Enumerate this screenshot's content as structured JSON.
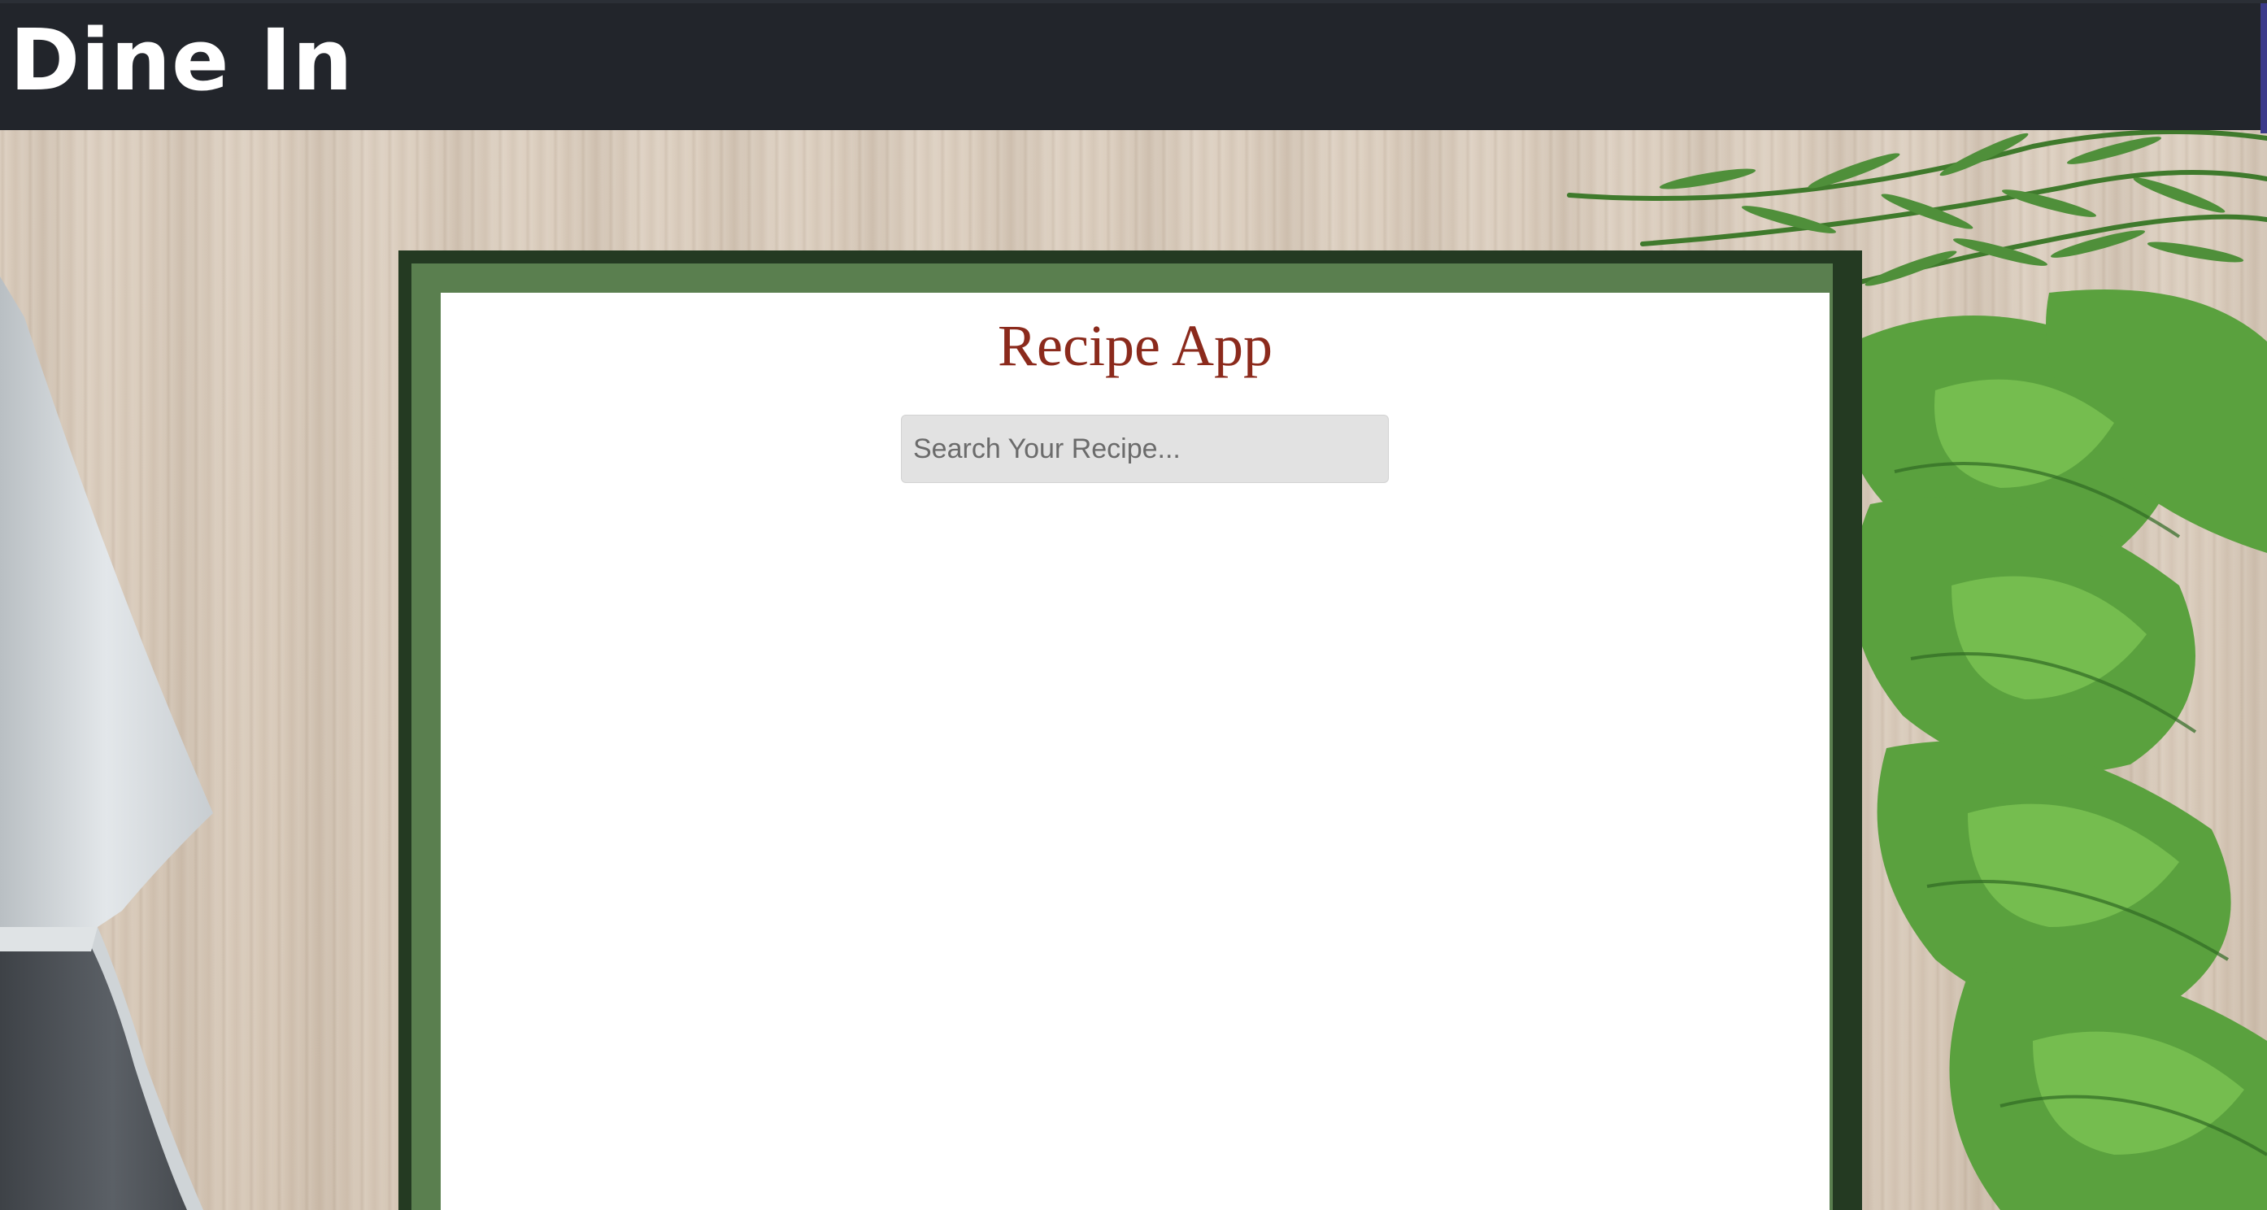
{
  "header": {
    "brand": "Dine In"
  },
  "main": {
    "title": "Recipe App",
    "search": {
      "placeholder": "Search Your Recipe...",
      "value": ""
    }
  },
  "colors": {
    "header_bg": "#22252b",
    "frame_dark": "#243a22",
    "frame_light": "#5a7f4f",
    "title": "#8b2a1c",
    "search_bg": "#e2e2e2"
  },
  "decor": {
    "left": "knife-image",
    "right": "herbs-image"
  }
}
